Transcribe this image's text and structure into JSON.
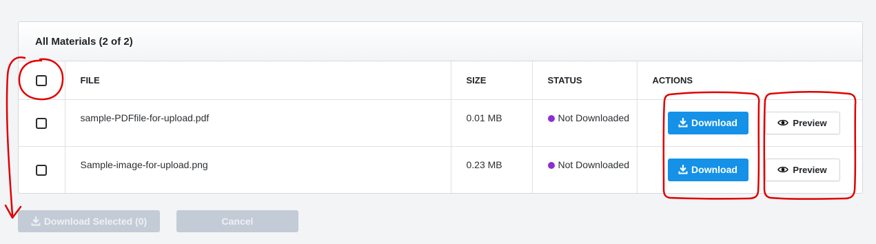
{
  "panel": {
    "title": "All Materials (2 of 2)"
  },
  "table": {
    "columns": {
      "file": "FILE",
      "size": "SIZE",
      "status": "STATUS",
      "actions": "ACTIONS"
    },
    "rows": [
      {
        "file": "sample-PDFfile-for-upload.pdf",
        "size": "0.01 MB",
        "status": "Not Downloaded",
        "download_label": "Download",
        "preview_label": "Preview"
      },
      {
        "file": "Sample-image-for-upload.png",
        "size": "0.23 MB",
        "status": "Not Downloaded",
        "download_label": "Download",
        "preview_label": "Preview"
      }
    ]
  },
  "footer": {
    "download_selected_label": "Download Selected (0)",
    "cancel_label": "Cancel"
  },
  "colors": {
    "primary": "#1591e8",
    "status_dot": "#8e2fd1",
    "disabled": "#c3cbd6",
    "annotation": "#e00000"
  }
}
